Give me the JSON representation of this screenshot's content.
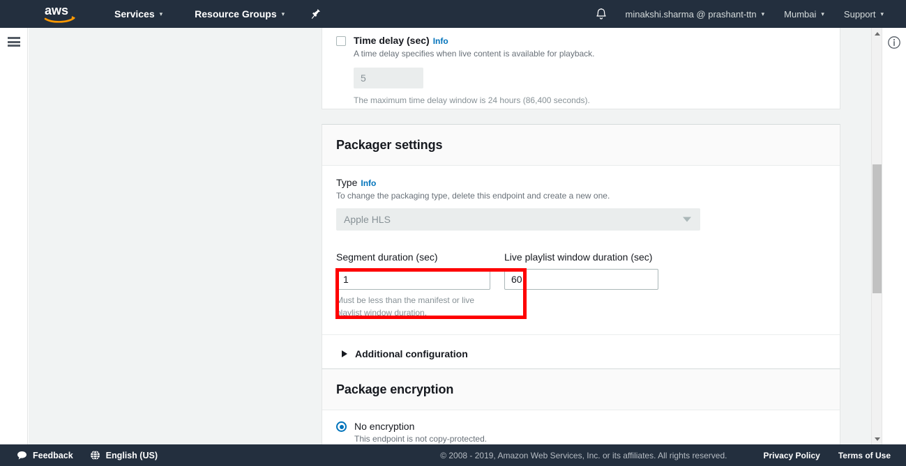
{
  "topnav": {
    "logo_alt": "aws",
    "services": "Services",
    "resource_groups": "Resource Groups",
    "pin_icon": "pin-icon",
    "bell_icon": "bell-icon",
    "account": "minakshi.sharma @ prashant-ttn",
    "region": "Mumbai",
    "support": "Support",
    "caret": "▾"
  },
  "rails": {
    "menu_icon": "hamburger-menu-icon",
    "info_icon": "info-circle-icon"
  },
  "time_delay": {
    "label": "Time delay (sec)",
    "info": "Info",
    "description": "A time delay specifies when live content is available for playback.",
    "value": "5",
    "hint": "The maximum time delay window is 24 hours (86,400 seconds).",
    "checked": false
  },
  "packager": {
    "title": "Packager settings",
    "type_label": "Type",
    "type_info": "Info",
    "type_desc": "To change the packaging type, delete this endpoint and create a new one.",
    "type_value": "Apple HLS",
    "type_options": [
      "Apple HLS"
    ],
    "segment_duration_label": "Segment duration (sec)",
    "segment_duration_value": "1",
    "segment_duration_hint": "Must be less than the manifest or live playlist window duration.",
    "playlist_window_label": "Live playlist window duration (sec)",
    "playlist_window_value": "60",
    "additional_config": "Additional configuration"
  },
  "encryption": {
    "title": "Package encryption",
    "option_label": "No encryption",
    "option_desc": "This endpoint is not copy-protected.",
    "selected": true
  },
  "footer": {
    "feedback": "Feedback",
    "language": "English (US)",
    "copyright": "© 2008 - 2019, Amazon Web Services, Inc. or its affiliates. All rights reserved.",
    "privacy": "Privacy Policy",
    "terms": "Terms of Use"
  },
  "colors": {
    "nav_bg": "#232f3e",
    "accent_blue": "#0073bb",
    "highlight_red": "#fe0000",
    "page_bg": "#f1f3f3"
  }
}
